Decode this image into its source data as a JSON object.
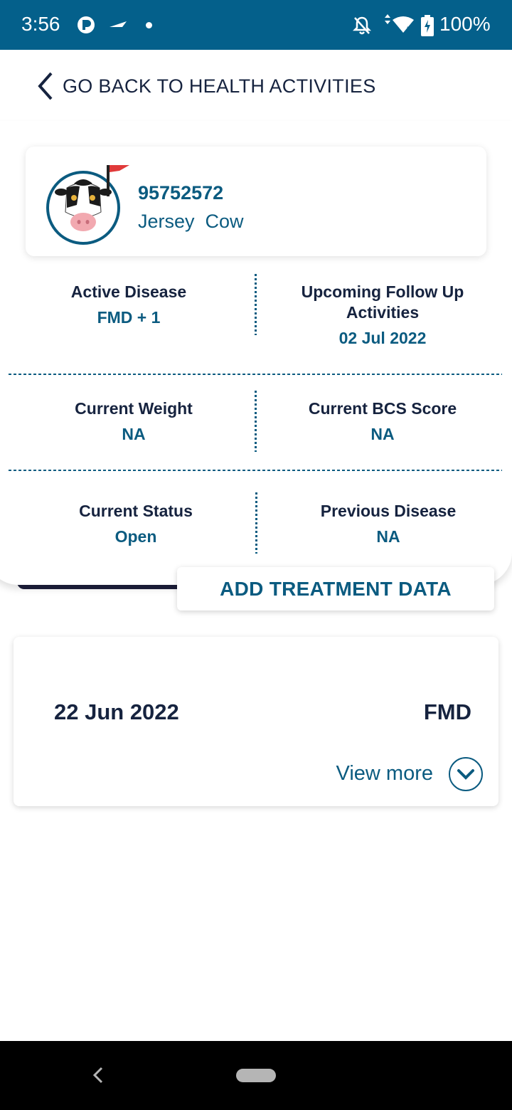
{
  "status_bar": {
    "time": "3:56",
    "battery": "100%",
    "color": "#04608b",
    "icons": [
      "app-icon",
      "navigation-icon",
      "dot",
      "mute-icon",
      "wifi-icon",
      "battery-icon"
    ]
  },
  "header": {
    "back_label": "GO BACK TO HEALTH ACTIVITIES"
  },
  "animal": {
    "id": "95752572",
    "breed": "Jersey  Cow",
    "avatar_icon": "cow-icon",
    "flag_color": "#e03a3a"
  },
  "stats": {
    "active_disease": {
      "label": "Active Disease",
      "value": "FMD + 1"
    },
    "follow_up": {
      "label": "Upcoming Follow Up Activities",
      "value": "02 Jul 2022"
    },
    "current_weight": {
      "label": "Current Weight",
      "value": "NA"
    },
    "bcs_score": {
      "label": "Current BCS Score",
      "value": "NA"
    },
    "current_status": {
      "label": "Current Status",
      "value": "Open"
    },
    "previous_disease": {
      "label": "Previous Disease",
      "value": "NA"
    }
  },
  "actions": {
    "add_treatment_label": "ADD TREATMENT DATA"
  },
  "records": [
    {
      "date": "22 Jun 2022",
      "disease": "FMD",
      "view_more_label": "View more"
    }
  ],
  "colors": {
    "primary": "#0b5b80",
    "text_dark": "#16233f"
  }
}
